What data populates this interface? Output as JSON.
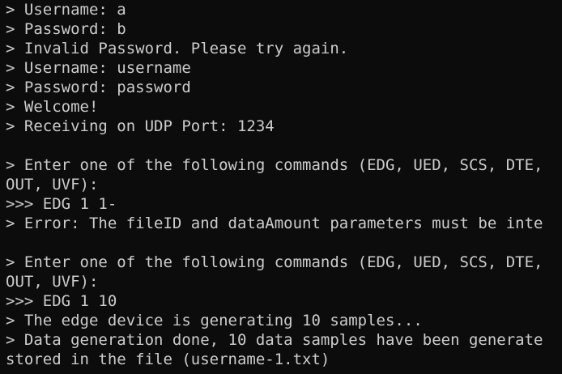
{
  "terminal": {
    "background": "#0c0c0c",
    "foreground": "#cccccc",
    "lines": [
      "> Username: a",
      "> Password: b",
      "> Invalid Password. Please try again.",
      "> Username: username",
      "> Password: password",
      "> Welcome!",
      "> Receiving on UDP Port: 1234",
      "",
      "> Enter one of the following commands (EDG, UED, SCS, DTE,",
      "OUT, UVF):",
      ">>> EDG 1 1-",
      "> Error: The fileID and dataAmount parameters must be inte",
      "",
      "> Enter one of the following commands (EDG, UED, SCS, DTE,",
      "OUT, UVF):",
      ">>> EDG 1 10",
      "> The edge device is generating 10 samples...",
      "> Data generation done, 10 data samples have been generate",
      "stored in the file (username-1.txt)"
    ]
  }
}
